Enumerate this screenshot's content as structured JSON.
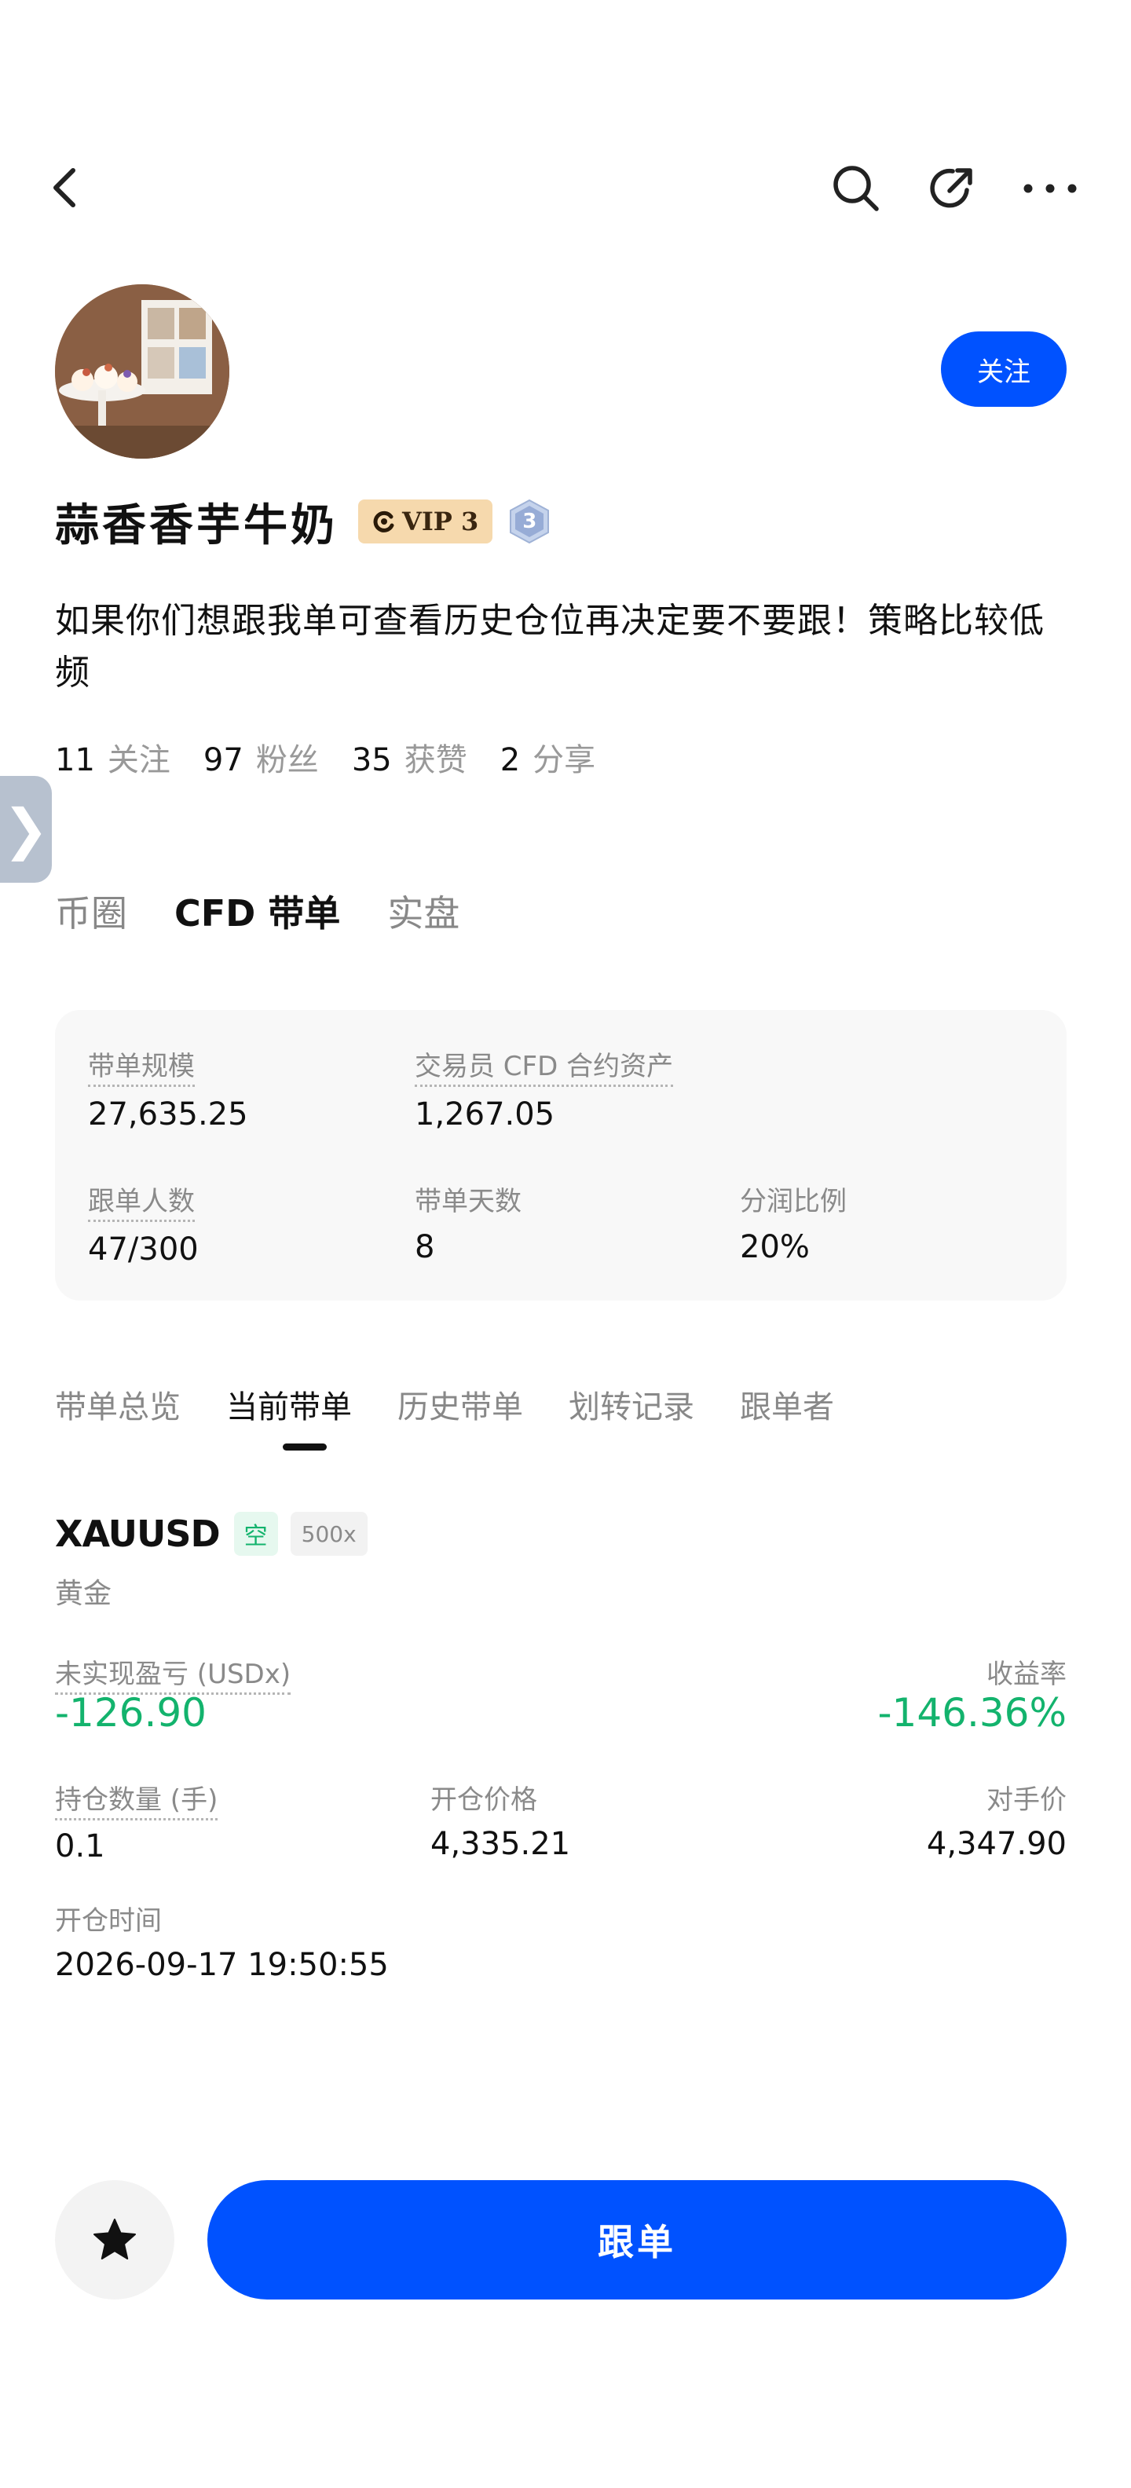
{
  "header": {
    "back_icon": "chevron-left-icon",
    "search_icon": "search-icon",
    "share_icon": "share-icon",
    "more_icon": "more-icon"
  },
  "profile": {
    "follow_label": "关注",
    "name": "蒜香香芋牛奶",
    "vip_label": "VIP 3",
    "level": "3",
    "bio": "如果你们想跟我单可查看历史仓位再决定要不要跟！策略比较低频",
    "stats": [
      {
        "value": "11",
        "label": "关注"
      },
      {
        "value": "97",
        "label": "粉丝"
      },
      {
        "value": "35",
        "label": "获赞"
      },
      {
        "value": "2",
        "label": "分享"
      }
    ]
  },
  "side_handle": "❯",
  "account_tabs": [
    {
      "label": "币圈",
      "active": false
    },
    {
      "label": "CFD 带单",
      "active": true
    },
    {
      "label": "实盘",
      "active": false
    }
  ],
  "summary": {
    "scale_label": "带单规模",
    "scale_value": "27,635.25",
    "assets_label": "交易员 CFD 合约资产",
    "assets_value": "1,267.05",
    "followers_label": "跟单人数",
    "followers_value": "47/300",
    "days_label": "带单天数",
    "days_value": "8",
    "share_label": "分润比例",
    "share_value": "20%"
  },
  "content_tabs": [
    {
      "label": "带单总览",
      "active": false
    },
    {
      "label": "当前带单",
      "active": true
    },
    {
      "label": "历史带单",
      "active": false
    },
    {
      "label": "划转记录",
      "active": false
    },
    {
      "label": "跟单者",
      "active": false
    }
  ],
  "position": {
    "symbol": "XAUUSD",
    "side": "空",
    "leverage": "500x",
    "name": "黄金",
    "pnl_label": "未实现盈亏 (USDx)",
    "pnl_value": "-126.90",
    "roe_label": "收益率",
    "roe_value": "-146.36%",
    "qty_label": "持仓数量 (手)",
    "qty_value": "0.1",
    "open_price_label": "开仓价格",
    "open_price_value": "4,335.21",
    "counter_price_label": "对手价",
    "counter_price_value": "4,347.90",
    "open_time_label": "开仓时间",
    "open_time_value": "2026-09-17 19:50:55"
  },
  "bottom": {
    "fav_icon": "star-icon",
    "copy_label": "跟单"
  },
  "colors": {
    "accent": "#0052ff",
    "positive_green": "#13b36d",
    "vip_bg": "#f6d9ad",
    "card_bg": "#f8f8f8"
  }
}
